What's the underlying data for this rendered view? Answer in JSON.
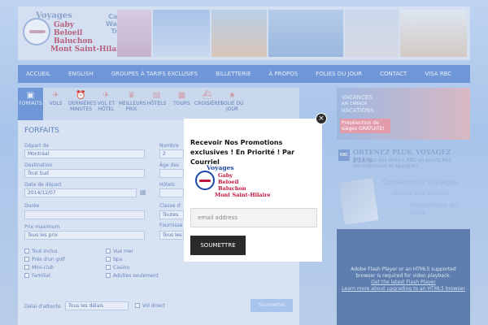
{
  "header": {
    "logo_lines": [
      "Voyages",
      "Gaby",
      "Beloeil",
      "Baluchon",
      "Mont Saint-Hilaire"
    ],
    "partner_lines": [
      "Carlson",
      "Wagonlit",
      "Travel"
    ]
  },
  "nav": [
    "ACCUEIL",
    "ENGLISH",
    "GROUPES À TARIFS EXCLUSIFS",
    "BILLETTERIE",
    "À PROPOS",
    "FOLIES DU JOUR",
    "CONTACT",
    "VISA RBC"
  ],
  "tabs": [
    {
      "label": "FORFAITS",
      "icon": "suitcase-icon",
      "active": true
    },
    {
      "label": "VOLS",
      "icon": "plane-icon"
    },
    {
      "label": "DERNIÈRES MINUTES",
      "icon": "alarm-clock-icon"
    },
    {
      "label": "VOL ET HÔTEL",
      "icon": "plane-hotel-icon"
    },
    {
      "label": "MEILLEURS PRIX",
      "icon": "trophy-icon"
    },
    {
      "label": "HÔTELS",
      "icon": "hotel-icon"
    },
    {
      "label": "TOURS",
      "icon": "bus-icon"
    },
    {
      "label": "CROISIÈRES",
      "icon": "ship-icon"
    },
    {
      "label": "FOLIE DU JOUR",
      "icon": "star-icon"
    }
  ],
  "form": {
    "title": "FORFAITS",
    "depart_label": "Départ de",
    "depart_value": "Montréal",
    "destination_label": "Destination",
    "destination_value": "Tout Sud",
    "date_label": "Date de départ",
    "date_value": "2014/12/07",
    "duree_label": "Durée",
    "prix_label": "Prix maximum",
    "prix_value": "Tous les prix",
    "nombre_label": "Nombre",
    "nombre_value": "2",
    "age_label": "Âge des",
    "hotels_label": "Hôtels",
    "classe_label": "Classe d'",
    "classe_value": "Toutes",
    "fournisseur_label": "Fournisse",
    "fournisseur_value": "Tous les",
    "checkboxes": [
      "Tout inclus",
      "Vue mer",
      "Près d'un golf",
      "Spa",
      "Mini-club",
      "Casino",
      "Familial",
      "Adultes seulement"
    ],
    "delai_label": "Délai d'attente",
    "delai_value": "Tous les délais",
    "vol_direct": "Vol direct",
    "submit": "Soumettre"
  },
  "ads": {
    "vacations_lines": [
      "VACANCES",
      "AIR CANADA",
      "VACATIONS"
    ],
    "vacations_badge": "Présélection de sièges GRATUITE!",
    "rbc_title": "OBTENEZ PLUS, VOYAGEZ PLUS",
    "rbc_sub": "Échangez des dollars RBC en points RBC Récompenses et épargnez",
    "rbc_logo": "RBC",
    "conf_title": "Conférence Voyages",
    "conf_sub": "Horaire des soirées!",
    "conf_cta": "Inscriptions en ligne"
  },
  "flash": {
    "message": "Adobe Flash Player or an HTML5 supported browser is required for video playback.",
    "link1": "Get the latest Flash Player",
    "link2": "Learn more about upgrading to an HTML5 browser"
  },
  "modal": {
    "title": "Recevoir Nos Promotions exclusives ! En Priorité ! Par Courriel",
    "logo_lines": [
      "Voyages",
      "Gaby",
      "Beloeil",
      "Baluchon",
      "Mont Saint-Hilaire"
    ],
    "email_placeholder": "email address",
    "submit": "SOUMETTRE",
    "close": "×"
  }
}
